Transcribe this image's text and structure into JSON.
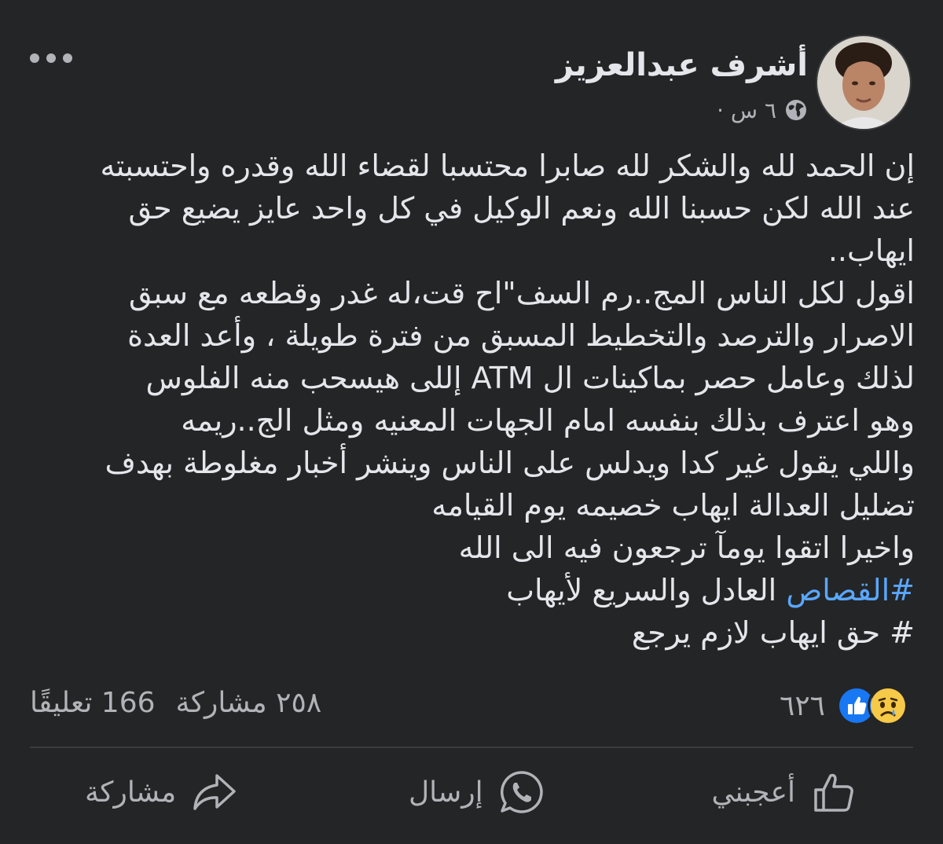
{
  "post": {
    "author": "أشرف عبدالعزيز",
    "time": "٦ س ·",
    "privacy_icon": "globe-icon",
    "lines": [
      "إن الحمد لله والشكر لله صابرا محتسبا لقضاء الله وقدره واحتسبته",
      "عند الله لكن حسبنا الله ونعم الوكيل في كل واحد عايز يضيع حق",
      "ايهاب..",
      "اقول لكل الناس المج..رم السف\"اح قت،له غدر وقطعه مع سبق",
      "الاصرار والترصد والتخطيط المسبق من فترة طويلة ، وأعد العدة",
      "لذلك وعامل حصر بماكينات ال ATM إللى  هيسحب منه الفلوس",
      "وهو اعترف بذلك بنفسه امام الجهات المعنيه ومثل الج..ريمه",
      "واللي يقول غير كدا ويدلس على الناس وينشر أخبار مغلوطة بهدف",
      "تضليل العدالة ايهاب خصيمه يوم القيامه",
      "واخيرا اتقوا يومآ ترجعون فيه الى الله"
    ],
    "hashtag1_tag": "#القصاص",
    "hashtag1_rest": " العادل والسريع لأيهاب",
    "hashtag2": "# حق ايهاب لازم يرجع"
  },
  "stats": {
    "reactions_count": "٦٢٦",
    "comments": "166 تعليقًا",
    "shares": "٢٥٨ مشاركة"
  },
  "actions": {
    "like": "أعجبني",
    "send": "إرسال",
    "share": "مشاركة"
  },
  "colors": {
    "background": "#242526",
    "text": "#e4e6eb",
    "secondary": "#b0b3b8",
    "hashtag": "#5aa7ff",
    "like_blue": "#1877f2"
  }
}
